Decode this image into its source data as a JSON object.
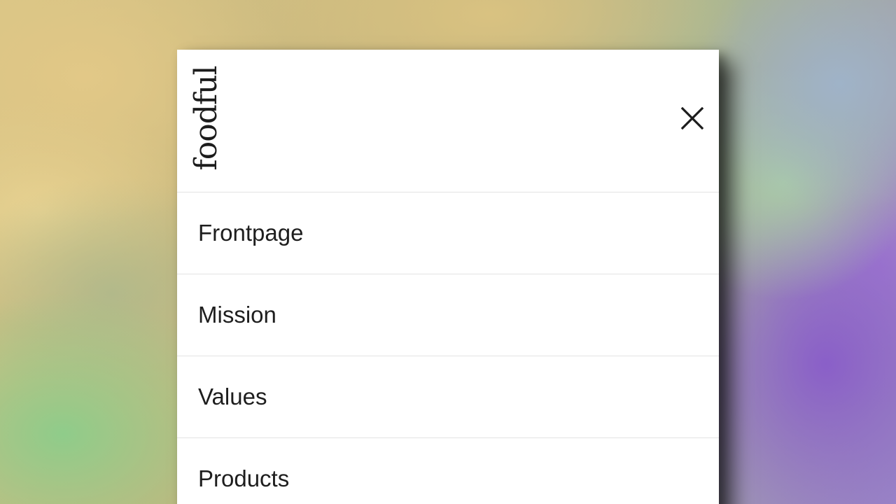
{
  "brand": {
    "logo_text": "foodful"
  },
  "header": {
    "close_icon": "close-icon"
  },
  "menu": {
    "items": [
      {
        "label": "Frontpage"
      },
      {
        "label": "Mission"
      },
      {
        "label": "Values"
      },
      {
        "label": "Products"
      }
    ]
  },
  "colors": {
    "panel_bg": "#ffffff",
    "text": "#1e1e1e",
    "divider": "#e3e3e3"
  }
}
